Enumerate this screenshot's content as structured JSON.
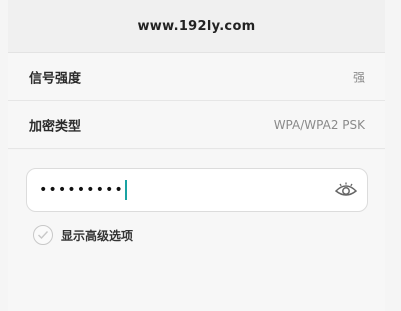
{
  "header": {
    "title": "www.192ly.com"
  },
  "signal": {
    "label": "信号强度",
    "value": "强"
  },
  "encryption": {
    "label": "加密类型",
    "value": "WPA/WPA2 PSK"
  },
  "password": {
    "value": "•••••••••"
  },
  "advanced": {
    "label": "显示高级选项",
    "checked": false
  },
  "icons": {
    "reveal": "eye-icon",
    "checkbox": "check-icon"
  },
  "colors": {
    "caret": "#1aa3a3"
  }
}
